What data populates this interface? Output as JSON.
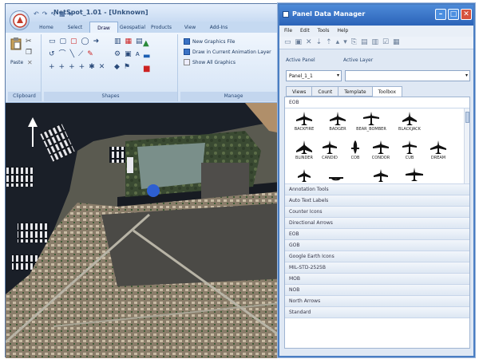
{
  "main": {
    "title": "NetSpot_1.01 - [Unknown]",
    "tabs": [
      "Home",
      "Select",
      "Draw",
      "Geospatial",
      "Products",
      "View",
      "Add-Ins"
    ],
    "groups": {
      "clipboard": "Clipboard",
      "shapes": "Shapes",
      "manage": "Manage"
    },
    "paste_label": "Paste",
    "graphics_buttons": [
      "New Graphics File",
      "Draw in Current Animation Layer",
      "Show All Graphics"
    ]
  },
  "panel": {
    "title": "Panel Data Manager",
    "menu": [
      "File",
      "Edit",
      "Tools",
      "Help"
    ],
    "active_panel_label": "Active Panel",
    "active_layer_label": "Active Layer",
    "active_panel_value": "Panel_1_1",
    "tabs": [
      "Views",
      "Count",
      "Template",
      "Toolbox"
    ],
    "selected_tab": "Toolbox",
    "expanded_category": "EOB",
    "symbols": [
      "BACKFIRE",
      "BADGER",
      "BEAR_BOMBER",
      "BLACKJACK",
      "BLINDER",
      "CANDID",
      "COB",
      "CONDOR",
      "CUB",
      "DREAM"
    ],
    "categories": [
      "Annotation Tools",
      "Auto Text Labels",
      "Counter Icons",
      "Directional Arrows",
      "EOB",
      "GOB",
      "Google Earth Icons",
      "MIL-STD-2525B",
      "MOB",
      "NOB",
      "North Arrows",
      "Standard"
    ]
  },
  "colors": {
    "accent": "#2b63b8",
    "ribbon": "#d4e3f5"
  }
}
